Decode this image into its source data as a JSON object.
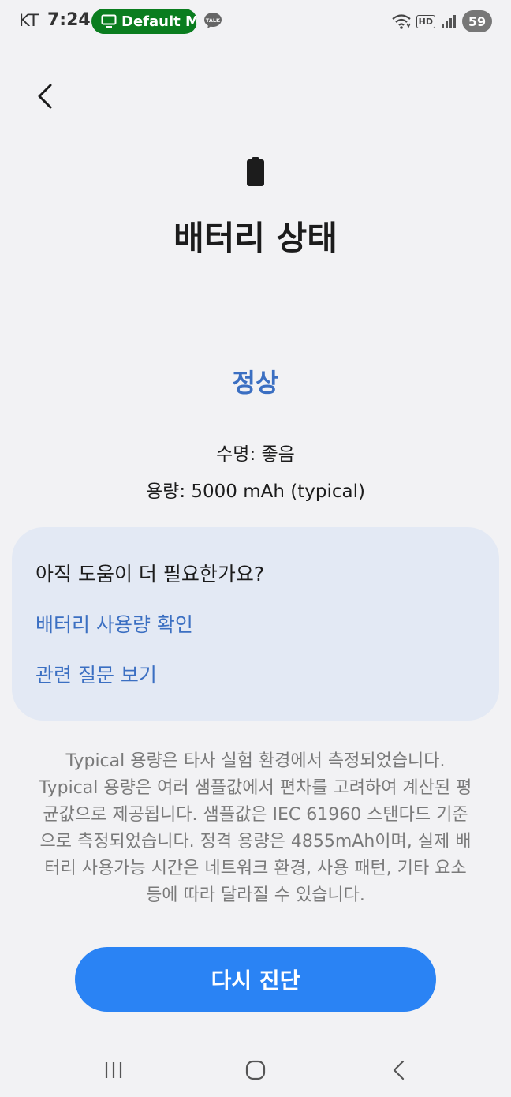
{
  "status_bar": {
    "carrier": "KT",
    "time": "7:24",
    "notification_pill": "Default M",
    "talk_icon_label": "TALK",
    "network_badge": "HD",
    "battery_level": "59"
  },
  "page": {
    "title": "배터리 상태",
    "status": "정상",
    "life": "수명: 좋음",
    "capacity": "용량: 5000 mAh (typical)"
  },
  "help_card": {
    "title": "아직 도움이 더 필요한가요?",
    "links": [
      "배터리 사용량 확인",
      "관련 질문 보기"
    ]
  },
  "disclaimer": "Typical 용량은 타사 실험 환경에서 측정되었습니다. Typical 용량은 여러 샘플값에서 편차를 고려하여 계산된 평균값으로 제공됩니다. 샘플값은 IEC 61960 스탠다드 기준으로 측정되었습니다. 정격 용량은 4855mAh이며, 실제 배터리 사용가능 시간은 네트워크 환경, 사용 패턴, 기타 요소 등에 따라 달라질 수 있습니다.",
  "action_button": "다시 진단",
  "colors": {
    "background": "#f2f2f4",
    "accent_text": "#3b6fc2",
    "button": "#2a83f4",
    "card": "#e3e9f4",
    "pill": "#0a7d1f"
  },
  "icons": [
    "back-arrow-icon",
    "battery-icon",
    "wifi-icon",
    "signal-icon",
    "recent-apps-icon",
    "home-icon",
    "nav-back-icon"
  ]
}
